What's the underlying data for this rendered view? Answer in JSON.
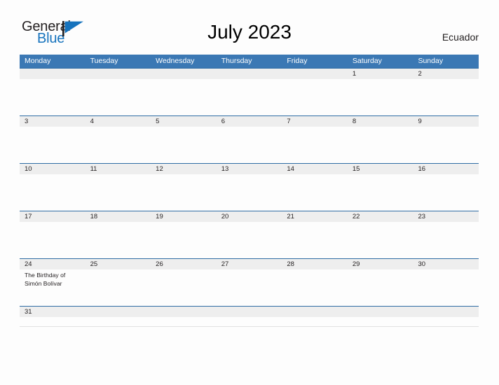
{
  "brand": {
    "word_one": "General",
    "word_two": "Blue",
    "flag_icon": "flag-triangle-icon",
    "brand_black": "#231f20",
    "brand_blue": "#1673bd"
  },
  "header": {
    "title": "July 2023",
    "region": "Ecuador"
  },
  "theme": {
    "header_blue": "#3b78b4",
    "row_divider_blue": "#2e6ca4",
    "day_band_gray": "#eeeeee",
    "page_background": "#fdfdfd",
    "text_color": "#231f20"
  },
  "calendar": {
    "month": "July",
    "year": "2023",
    "first_day_of_week": "Monday",
    "day_headers": [
      "Monday",
      "Tuesday",
      "Wednesday",
      "Thursday",
      "Friday",
      "Saturday",
      "Sunday"
    ],
    "weeks": [
      [
        {
          "date": "",
          "events": []
        },
        {
          "date": "",
          "events": []
        },
        {
          "date": "",
          "events": []
        },
        {
          "date": "",
          "events": []
        },
        {
          "date": "",
          "events": []
        },
        {
          "date": "1",
          "events": []
        },
        {
          "date": "2",
          "events": []
        }
      ],
      [
        {
          "date": "3",
          "events": []
        },
        {
          "date": "4",
          "events": []
        },
        {
          "date": "5",
          "events": []
        },
        {
          "date": "6",
          "events": []
        },
        {
          "date": "7",
          "events": []
        },
        {
          "date": "8",
          "events": []
        },
        {
          "date": "9",
          "events": []
        }
      ],
      [
        {
          "date": "10",
          "events": []
        },
        {
          "date": "11",
          "events": []
        },
        {
          "date": "12",
          "events": []
        },
        {
          "date": "13",
          "events": []
        },
        {
          "date": "14",
          "events": []
        },
        {
          "date": "15",
          "events": []
        },
        {
          "date": "16",
          "events": []
        }
      ],
      [
        {
          "date": "17",
          "events": []
        },
        {
          "date": "18",
          "events": []
        },
        {
          "date": "19",
          "events": []
        },
        {
          "date": "20",
          "events": []
        },
        {
          "date": "21",
          "events": []
        },
        {
          "date": "22",
          "events": []
        },
        {
          "date": "23",
          "events": []
        }
      ],
      [
        {
          "date": "24",
          "events": [
            "The Birthday of Simón Bolívar"
          ]
        },
        {
          "date": "25",
          "events": []
        },
        {
          "date": "26",
          "events": []
        },
        {
          "date": "27",
          "events": []
        },
        {
          "date": "28",
          "events": []
        },
        {
          "date": "29",
          "events": []
        },
        {
          "date": "30",
          "events": []
        }
      ],
      [
        {
          "date": "31",
          "events": []
        },
        {
          "date": "",
          "events": []
        },
        {
          "date": "",
          "events": []
        },
        {
          "date": "",
          "events": []
        },
        {
          "date": "",
          "events": []
        },
        {
          "date": "",
          "events": []
        },
        {
          "date": "",
          "events": []
        }
      ]
    ]
  }
}
